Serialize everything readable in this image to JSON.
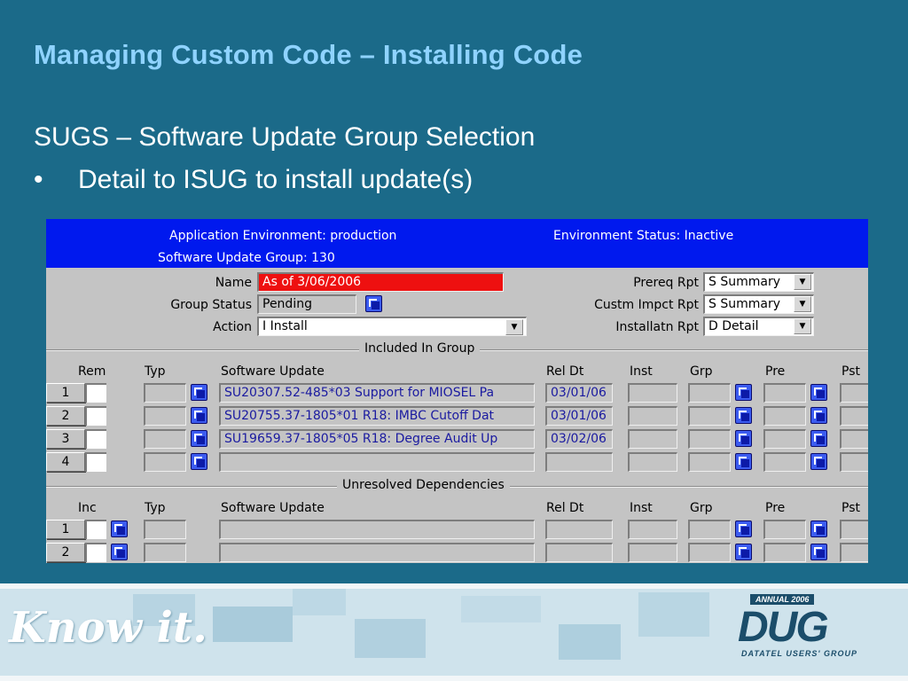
{
  "slide": {
    "title": "Managing Custom Code – Installing Code",
    "subtitle": "SUGS – Software Update Group Selection",
    "bullet_mark": "•",
    "bullet": "Detail to ISUG to  install update(s)"
  },
  "screen": {
    "header": {
      "app_env": "Application Environment:  production",
      "env_status": "Environment Status:  Inactive",
      "sug": "Software Update Group:  130"
    },
    "form": {
      "name_label": "Name",
      "name_value": "As of 3/06/2006",
      "group_status_label": "Group Status",
      "group_status_value": "Pending",
      "action_label": "Action",
      "action_value": "I Install",
      "prereq_label": "Prereq Rpt",
      "prereq_value": "S Summary",
      "custm_label": "Custm Impct Rpt",
      "custm_value": "S Summary",
      "install_label": "Installatn Rpt",
      "install_value": "D Detail"
    },
    "included": {
      "section_title": "Included In Group",
      "columns": {
        "rem": "Rem",
        "typ": "Typ",
        "software_update": "Software Update",
        "rel_dt": "Rel Dt",
        "inst": "Inst",
        "grp": "Grp",
        "pre": "Pre",
        "pst": "Pst"
      },
      "rows": [
        {
          "num": "1",
          "update": "SU20307.52-485*03 Support for MIOSEL Pa",
          "rel_dt": "03/01/06"
        },
        {
          "num": "2",
          "update": "SU20755.37-1805*01 R18: IMBC Cutoff Dat",
          "rel_dt": "03/01/06"
        },
        {
          "num": "3",
          "update": "SU19659.37-1805*05 R18: Degree Audit Up",
          "rel_dt": "03/02/06"
        },
        {
          "num": "4",
          "update": "",
          "rel_dt": ""
        }
      ]
    },
    "unresolved": {
      "section_title": "Unresolved Dependencies",
      "columns": {
        "inc": "Inc",
        "typ": "Typ",
        "software_update": "Software Update",
        "rel_dt": "Rel Dt",
        "inst": "Inst",
        "grp": "Grp",
        "pre": "Pre",
        "pst": "Pst"
      },
      "rows": [
        {
          "num": "1"
        },
        {
          "num": "2"
        }
      ]
    }
  },
  "footer": {
    "tagline": "Know it.",
    "logo_annual": "ANNUAL 2006",
    "logo_text": "DUG",
    "logo_sub": "DATATEL USERS' GROUP"
  },
  "colors": {
    "background": "#1b6a89",
    "title": "#8fd3ff",
    "screen_header": "#0019ee",
    "name_field": "#ee1010"
  }
}
